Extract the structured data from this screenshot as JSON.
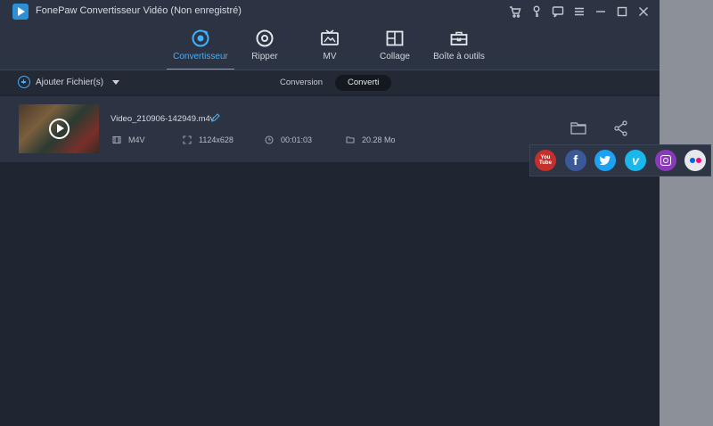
{
  "window": {
    "title": "FonePaw Convertisseur Vidéo (Non enregistré)"
  },
  "nav": {
    "items": [
      {
        "label": "Convertisseur",
        "icon": "convert-icon",
        "active": true
      },
      {
        "label": "Ripper",
        "icon": "disc-icon",
        "active": false
      },
      {
        "label": "MV",
        "icon": "tv-icon",
        "active": false
      },
      {
        "label": "Collage",
        "icon": "collage-icon",
        "active": false
      },
      {
        "label": "Boîte à outils",
        "icon": "toolbox-icon",
        "active": false
      }
    ],
    "accent": "#3fb1ff"
  },
  "subbar": {
    "add_files_label": "Ajouter Fichier(s)",
    "tabs": [
      {
        "label": "Conversion",
        "active": false
      },
      {
        "label": "Converti",
        "active": true
      }
    ]
  },
  "file": {
    "name": "Video_210906-142949.m4v",
    "format": "M4V",
    "resolution": "1124x628",
    "duration": "00:01:03",
    "size": "20.28 Mo"
  },
  "share": {
    "services": [
      {
        "name": "YouTube",
        "label_top": "You",
        "label_bottom": "Tube",
        "color": "#c4302b"
      },
      {
        "name": "Facebook",
        "glyph": "f",
        "color": "#3b5998"
      },
      {
        "name": "Twitter",
        "glyph": "t",
        "color": "#1da1f2"
      },
      {
        "name": "Vimeo",
        "glyph": "v",
        "color": "#1ab7ea"
      },
      {
        "name": "Instagram",
        "color": "#8a3ab9"
      },
      {
        "name": "Flickr",
        "colors": [
          "#0063dc",
          "#ff0084"
        ]
      }
    ]
  }
}
